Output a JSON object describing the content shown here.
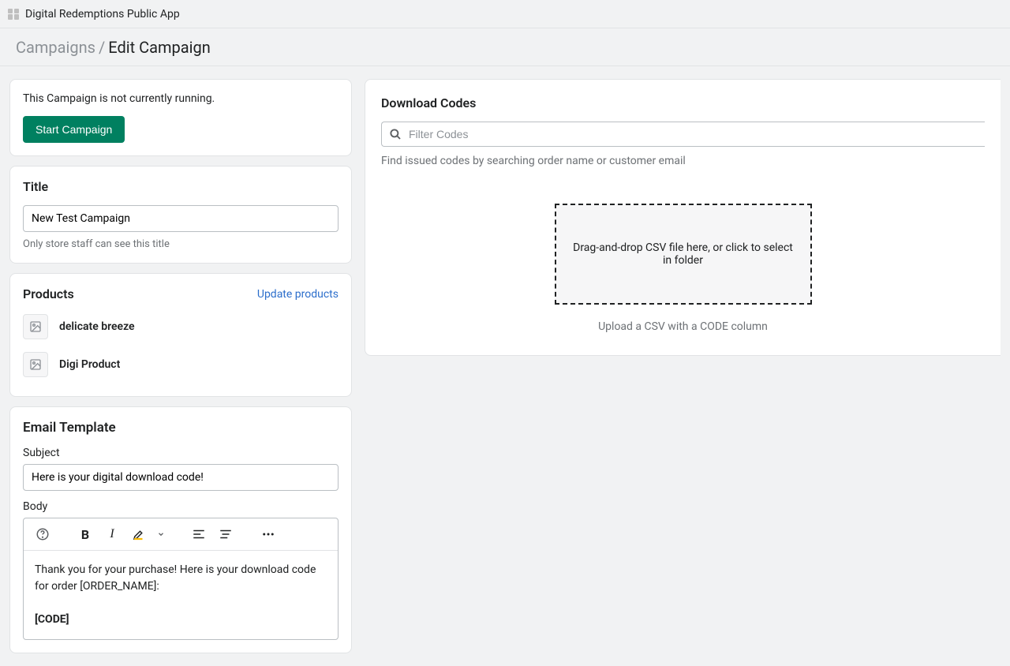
{
  "header": {
    "app_title": "Digital Redemptions Public App"
  },
  "breadcrumb": {
    "parent": "Campaigns",
    "current": "Edit Campaign"
  },
  "status": {
    "text": "This Campaign is not currently running.",
    "start_button": "Start Campaign"
  },
  "title_card": {
    "heading": "Title",
    "value": "New Test Campaign",
    "helper": "Only store staff can see this title"
  },
  "products": {
    "heading": "Products",
    "update_link": "Update products",
    "items": [
      {
        "name": "delicate breeze"
      },
      {
        "name": "Digi Product"
      }
    ]
  },
  "email": {
    "heading": "Email Template",
    "subject_label": "Subject",
    "subject_value": "Here is your digital download code!",
    "body_label": "Body",
    "body_line1": "Thank you for your purchase! Here is your download code for order [ORDER_NAME]:",
    "body_line2": "[CODE]"
  },
  "downloads": {
    "heading": "Download Codes",
    "filter_placeholder": "Filter Codes",
    "filter_helper": "Find issued codes by searching order name or customer email",
    "dropzone_text": "Drag-and-drop CSV file here, or click to select in folder",
    "dropzone_helper": "Upload a CSV with a CODE column"
  }
}
